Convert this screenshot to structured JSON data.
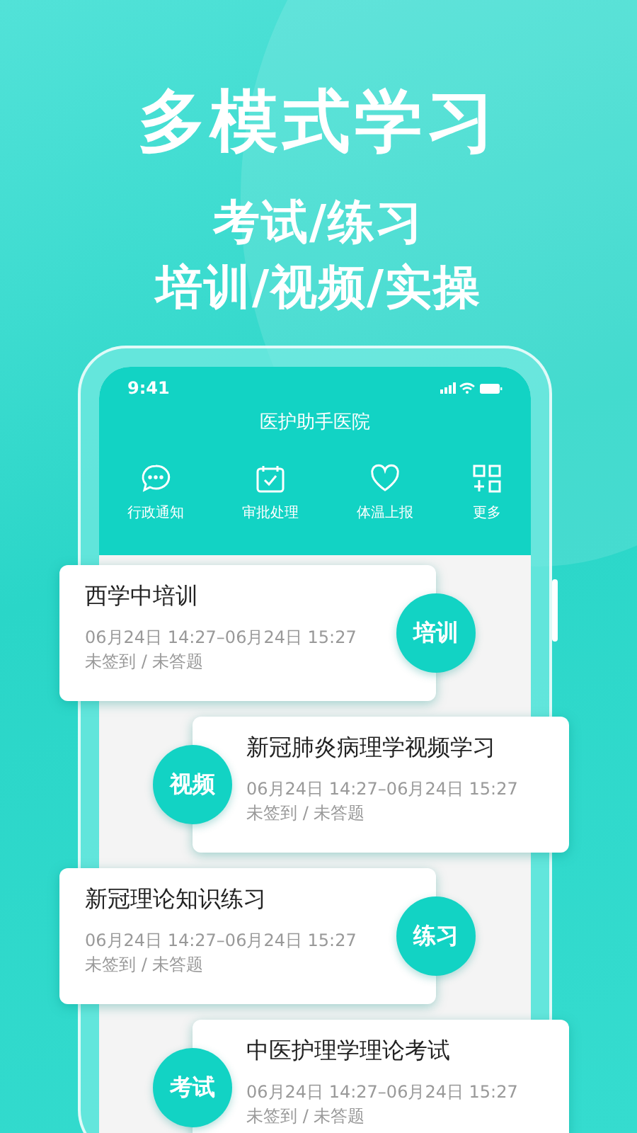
{
  "headline": "多模式学习",
  "subtitles": [
    "考试/练习",
    "培训/视频/实操"
  ],
  "phone": {
    "status_time": "9:41",
    "title": "医护助手医院",
    "shortcuts": [
      {
        "kind": "chat",
        "label": "行政通知"
      },
      {
        "kind": "calendar",
        "label": "审批处理"
      },
      {
        "kind": "heart",
        "label": "体温上报"
      },
      {
        "kind": "grid",
        "label": "更多"
      }
    ],
    "cards": [
      {
        "kind": "badge-right",
        "title": "西学中培训",
        "time": "06月24日 14:27–06月24日 15:27",
        "status": "未签到 / 未答题",
        "badge": "培训"
      },
      {
        "kind": "badge-left",
        "title": "新冠肺炎病理学视频学习",
        "time": "06月24日 14:27–06月24日 15:27",
        "status": "未签到 / 未答题",
        "badge": "视频"
      },
      {
        "kind": "badge-right",
        "title": "新冠理论知识练习",
        "time": "06月24日 14:27–06月24日 15:27",
        "status": "未签到 / 未答题",
        "badge": "练习"
      },
      {
        "kind": "badge-left",
        "title": "中医护理学理论考试",
        "time": "06月24日 14:27–06月24日 15:27",
        "status": "未签到 / 未答题",
        "badge": "考试"
      }
    ]
  }
}
